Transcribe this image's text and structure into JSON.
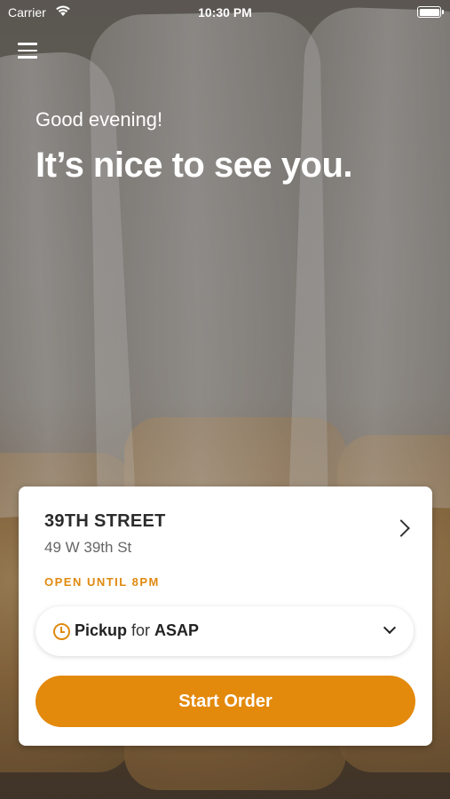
{
  "status_bar": {
    "carrier": "Carrier",
    "time": "10:30 PM"
  },
  "hero": {
    "greeting": "Good evening!",
    "headline": "It’s nice to see you."
  },
  "location": {
    "name": "39TH STREET",
    "address": "49 W 39th St",
    "hours": "OPEN UNTIL 8PM"
  },
  "order_mode": {
    "mode": "Pickup",
    "connector": " for ",
    "time": "ASAP"
  },
  "actions": {
    "start_order": "Start Order"
  },
  "colors": {
    "accent": "#e3890c",
    "text_dark": "#2b2b2b",
    "text_muted": "#666666"
  }
}
